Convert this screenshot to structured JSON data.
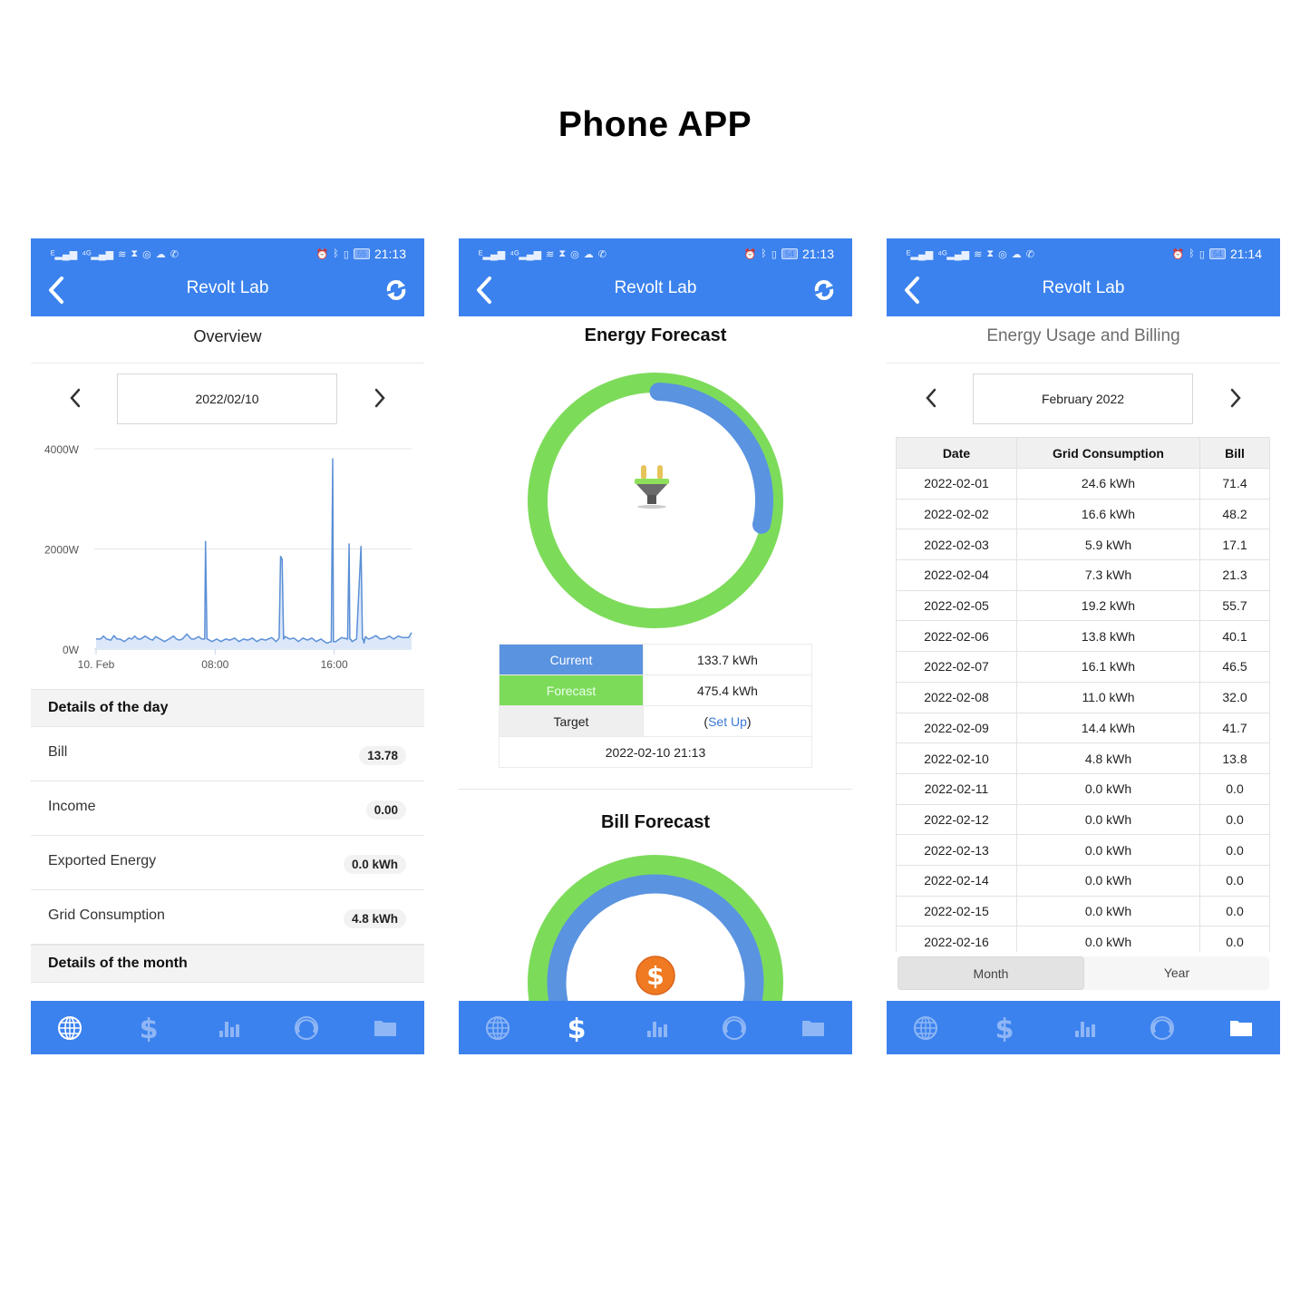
{
  "page": {
    "title": "Phone APP"
  },
  "colors": {
    "appbar": "#3b82ee",
    "green": "#7ddb5a",
    "blue": "#5a93e0",
    "tab_inactive": "#8fb6f5",
    "tab_active": "#ffffff"
  },
  "statusbar_icons": [
    "signal-icon",
    "signal-4g-icon",
    "wifi-icon",
    "hourglass-icon",
    "instagram-icon",
    "cloud-icon",
    "whatsapp-icon",
    "alarm-icon",
    "bluetooth-icon",
    "vibrate-icon",
    "battery-icon"
  ],
  "tabs": [
    {
      "name": "globe-icon"
    },
    {
      "name": "dollar-icon"
    },
    {
      "name": "bar-chart-icon"
    },
    {
      "name": "gauge-icon"
    },
    {
      "name": "folder-icon"
    }
  ],
  "screens": {
    "overview": {
      "status": {
        "battery": "55",
        "time": "21:13"
      },
      "app_title": "Revolt Lab",
      "subtitle": "Overview",
      "date": "2022/02/10",
      "active_tab": 0,
      "details_day_title": "Details of the day",
      "details": [
        {
          "label": "Bill",
          "value": "13.78"
        },
        {
          "label": "Income",
          "value": "0.00"
        },
        {
          "label": "Exported Energy",
          "value": "0.0 kWh"
        },
        {
          "label": "Grid Consumption",
          "value": "4.8 kWh"
        }
      ],
      "details_month_title": "Details of the month"
    },
    "energy_forecast": {
      "status": {
        "battery": "54",
        "time": "21:13"
      },
      "app_title": "Revolt Lab",
      "title": "Energy Forecast",
      "current_fraction": 0.281,
      "rows": {
        "current_label": "Current",
        "current_value": "133.7 kWh",
        "forecast_label": "Forecast",
        "forecast_value": "475.4 kWh",
        "target_label": "Target",
        "target_open": "(",
        "target_link": "Set Up",
        "target_close": ")",
        "timestamp": "2022-02-10 21:13"
      },
      "bill_title": "Bill Forecast",
      "active_tab": 1
    },
    "usage_billing": {
      "status": {
        "battery": "54",
        "time": "21:14"
      },
      "app_title": "Revolt Lab",
      "subtitle": "Energy Usage and Billing",
      "month": "February 2022",
      "columns": [
        "Date",
        "Grid Consumption",
        "Bill"
      ],
      "rows": [
        [
          "2022-02-01",
          "24.6 kWh",
          "71.4"
        ],
        [
          "2022-02-02",
          "16.6 kWh",
          "48.2"
        ],
        [
          "2022-02-03",
          "5.9 kWh",
          "17.1"
        ],
        [
          "2022-02-04",
          "7.3 kWh",
          "21.3"
        ],
        [
          "2022-02-05",
          "19.2 kWh",
          "55.7"
        ],
        [
          "2022-02-06",
          "13.8 kWh",
          "40.1"
        ],
        [
          "2022-02-07",
          "16.1 kWh",
          "46.5"
        ],
        [
          "2022-02-08",
          "11.0 kWh",
          "32.0"
        ],
        [
          "2022-02-09",
          "14.4 kWh",
          "41.7"
        ],
        [
          "2022-02-10",
          "4.8 kWh",
          "13.8"
        ],
        [
          "2022-02-11",
          "0.0 kWh",
          "0.0"
        ],
        [
          "2022-02-12",
          "0.0 kWh",
          "0.0"
        ],
        [
          "2022-02-13",
          "0.0 kWh",
          "0.0"
        ],
        [
          "2022-02-14",
          "0.0 kWh",
          "0.0"
        ],
        [
          "2022-02-15",
          "0.0 kWh",
          "0.0"
        ],
        [
          "2022-02-16",
          "0.0 kWh",
          "0.0"
        ]
      ],
      "segments": [
        "Month",
        "Year"
      ],
      "active_segment": 0,
      "active_tab": 4
    }
  },
  "chart_data": {
    "type": "area",
    "title": "",
    "xlabel": "",
    "ylabel": "",
    "y_ticks": [
      "0W",
      "2000W",
      "4000W"
    ],
    "ylim": [
      0,
      4000
    ],
    "x_ticks": [
      {
        "label": "10. Feb",
        "hour": 0
      },
      {
        "label": "08:00",
        "hour": 8
      },
      {
        "label": "16:00",
        "hour": 16
      }
    ],
    "xlim_hours": [
      0,
      21.2
    ],
    "grid": true,
    "series": [
      {
        "name": "Power (W)",
        "x_hours": [
          0,
          0.3,
          0.5,
          0.7,
          1.0,
          1.2,
          1.4,
          1.6,
          1.9,
          2.2,
          2.4,
          2.6,
          2.8,
          3.0,
          3.3,
          3.6,
          3.8,
          4.0,
          4.3,
          4.6,
          4.9,
          5.2,
          5.4,
          5.6,
          5.8,
          6.1,
          6.4,
          6.6,
          6.9,
          7.1,
          7.3,
          7.35,
          7.45,
          7.5,
          7.6,
          7.8,
          8.1,
          8.4,
          8.7,
          9.0,
          9.3,
          9.6,
          9.9,
          10.2,
          10.5,
          10.8,
          11.1,
          11.4,
          11.8,
          12.1,
          12.3,
          12.4,
          12.5,
          12.6,
          12.7,
          13.0,
          13.3,
          13.6,
          13.9,
          14.2,
          14.5,
          14.8,
          15.1,
          15.5,
          15.8,
          15.9,
          15.95,
          16.0,
          16.05,
          16.1,
          16.5,
          16.9,
          17.0,
          17.05,
          17.1,
          17.2,
          17.5,
          17.8,
          17.9,
          17.95,
          18.0,
          18.1,
          18.3,
          18.5,
          18.8,
          19.1,
          19.4,
          19.7,
          20.0,
          20.3,
          20.6,
          21.0,
          21.2
        ],
        "y_watts": [
          200,
          200,
          260,
          200,
          180,
          270,
          200,
          200,
          150,
          220,
          200,
          260,
          200,
          200,
          260,
          200,
          180,
          250,
          200,
          150,
          200,
          260,
          200,
          180,
          200,
          300,
          200,
          200,
          250,
          200,
          200,
          2150,
          200,
          200,
          180,
          150,
          200,
          150,
          200,
          180,
          220,
          150,
          200,
          180,
          220,
          150,
          200,
          180,
          230,
          150,
          220,
          1850,
          1800,
          200,
          250,
          200,
          220,
          150,
          220,
          180,
          220,
          150,
          200,
          120,
          150,
          3800,
          150,
          150,
          150,
          150,
          230,
          200,
          2100,
          200,
          200,
          150,
          200,
          2050,
          200,
          200,
          120,
          250,
          200,
          220,
          270,
          200,
          210,
          260,
          200,
          260,
          230,
          230,
          330
        ]
      }
    ]
  }
}
